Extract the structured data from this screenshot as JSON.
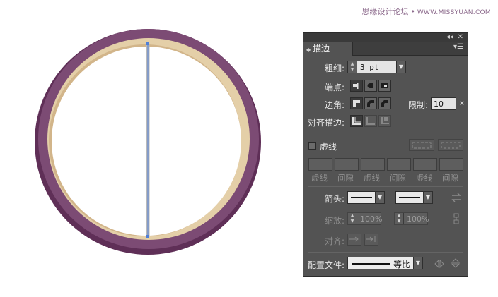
{
  "watermark": {
    "cn": "思缘设计论坛",
    "site": "WWW.MISSYUAN.COM"
  },
  "colors": {
    "ring_outer": "#7a4a72",
    "ring_inner": "#e9d8b8",
    "panel_bg": "#535353"
  },
  "panel": {
    "title": "描边",
    "collapse_icon": "double-left-arrow-icon",
    "close_icon": "close-icon",
    "menu_icon": "panel-menu-icon",
    "weight": {
      "label": "粗细:",
      "value": "3 pt"
    },
    "cap": {
      "label": "端点:"
    },
    "corner": {
      "label": "边角:",
      "limit_label": "限制:",
      "limit_value": "10",
      "limit_unit": "x"
    },
    "align": {
      "label": "对齐描边:"
    },
    "dashed": {
      "label": "虚线",
      "columns": [
        "虚线",
        "间隙",
        "虚线",
        "间隙",
        "虚线",
        "间隙"
      ]
    },
    "arrowheads": {
      "label": "箭头:"
    },
    "scale": {
      "label": "缩放:",
      "start": "100%",
      "end": "100%"
    },
    "arrow_align": {
      "label": "对齐:"
    },
    "profile": {
      "label": "配置文件:",
      "value": "等比"
    }
  }
}
